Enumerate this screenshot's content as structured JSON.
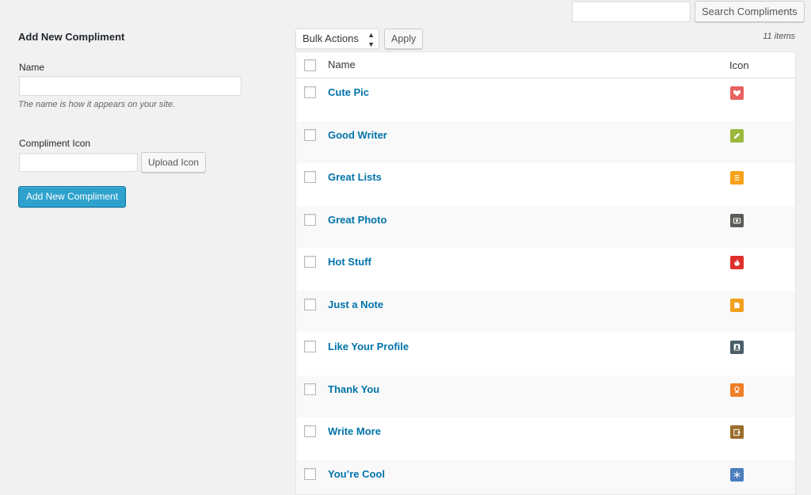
{
  "search": {
    "button_label": "Search Compliments",
    "value": ""
  },
  "form": {
    "title": "Add New Compliment",
    "name_label": "Name",
    "name_value": "",
    "name_hint": "The name is how it appears on your site.",
    "icon_label": "Compliment Icon",
    "icon_value": "",
    "upload_label": "Upload Icon",
    "submit_label": "Add New Compliment"
  },
  "toolbar": {
    "bulk_selected": "Bulk Actions",
    "apply_label": "Apply",
    "items_count": "11 items"
  },
  "table": {
    "columns": {
      "name": "Name",
      "icon": "Icon"
    },
    "rows": [
      {
        "name": "Cute Pic",
        "icon": "heart-icon",
        "color": "#e8625f"
      },
      {
        "name": "Good Writer",
        "icon": "pencil-icon",
        "color": "#9ab83c"
      },
      {
        "name": "Great Lists",
        "icon": "list-icon",
        "color": "#f7a21b"
      },
      {
        "name": "Great Photo",
        "icon": "camera-icon",
        "color": "#5a5d57"
      },
      {
        "name": "Hot Stuff",
        "icon": "flame-icon",
        "color": "#e0302c"
      },
      {
        "name": "Just a Note",
        "icon": "note-icon",
        "color": "#f0a01e"
      },
      {
        "name": "Like Your Profile",
        "icon": "profile-icon",
        "color": "#4b5e68"
      },
      {
        "name": "Thank You",
        "icon": "ribbon-icon",
        "color": "#f07f26"
      },
      {
        "name": "Write More",
        "icon": "write-more-icon",
        "color": "#9a6d2a"
      },
      {
        "name": "You’re Cool",
        "icon": "snowflake-icon",
        "color": "#4b7fbf"
      }
    ]
  }
}
